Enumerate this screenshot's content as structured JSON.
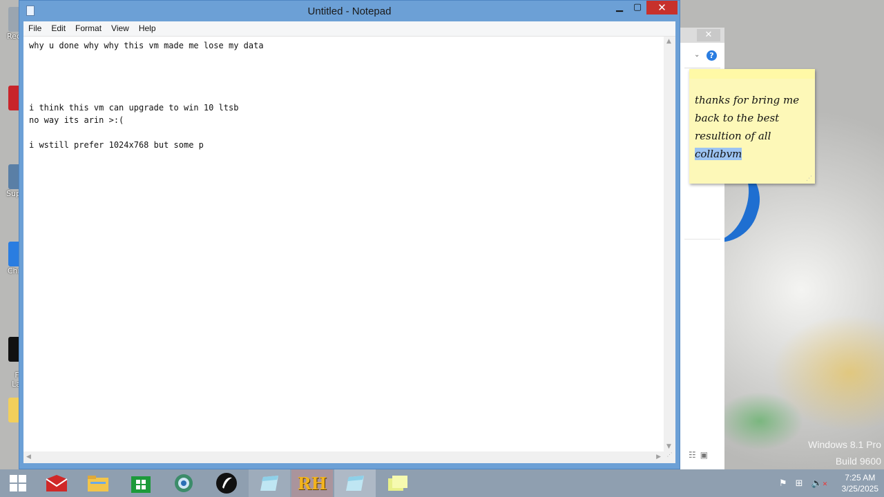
{
  "desktop": {
    "icons": [
      {
        "label": "Rec"
      },
      {
        "label": ""
      },
      {
        "label": "Sup"
      },
      {
        "label": "Chr"
      },
      {
        "label": "Fi\nLa"
      }
    ],
    "watermark": {
      "line1": "Windows 8.1 Pro",
      "line2": "Build 9600"
    }
  },
  "notepad": {
    "title": "Untitled - Notepad",
    "menu": [
      "File",
      "Edit",
      "Format",
      "View",
      "Help"
    ],
    "text": "why u done why why this vm made me lose my data\n\n\n\n\ni think this vm can upgrade to win 10 ltsb\nno way its arin >:(\n\ni wstill prefer 1024x768 but some p"
  },
  "sticky_note": {
    "text_plain": "thanks for bring me\nback to the best\nresultion of all ",
    "text_selected": "collabvm"
  },
  "taskbar": {
    "items": [
      {
        "name": "start-button"
      },
      {
        "name": "app-red-icon"
      },
      {
        "name": "file-explorer-icon"
      },
      {
        "name": "store-icon"
      },
      {
        "name": "globe-icon"
      },
      {
        "name": "black-logo-icon"
      },
      {
        "name": "notepad-task-icon"
      },
      {
        "name": "rh-icon"
      },
      {
        "name": "notepad-task-active-icon"
      },
      {
        "name": "sticky-notes-icon"
      }
    ],
    "rh_label": "RH",
    "clock_time": "7:25 AM",
    "clock_date": "3/25/2025"
  },
  "colors": {
    "titlebar": "#6ca0d6",
    "close_red": "#c7312c",
    "sticky_yellow": "#fdf8b8",
    "selection_blue": "#9cc3f2"
  }
}
